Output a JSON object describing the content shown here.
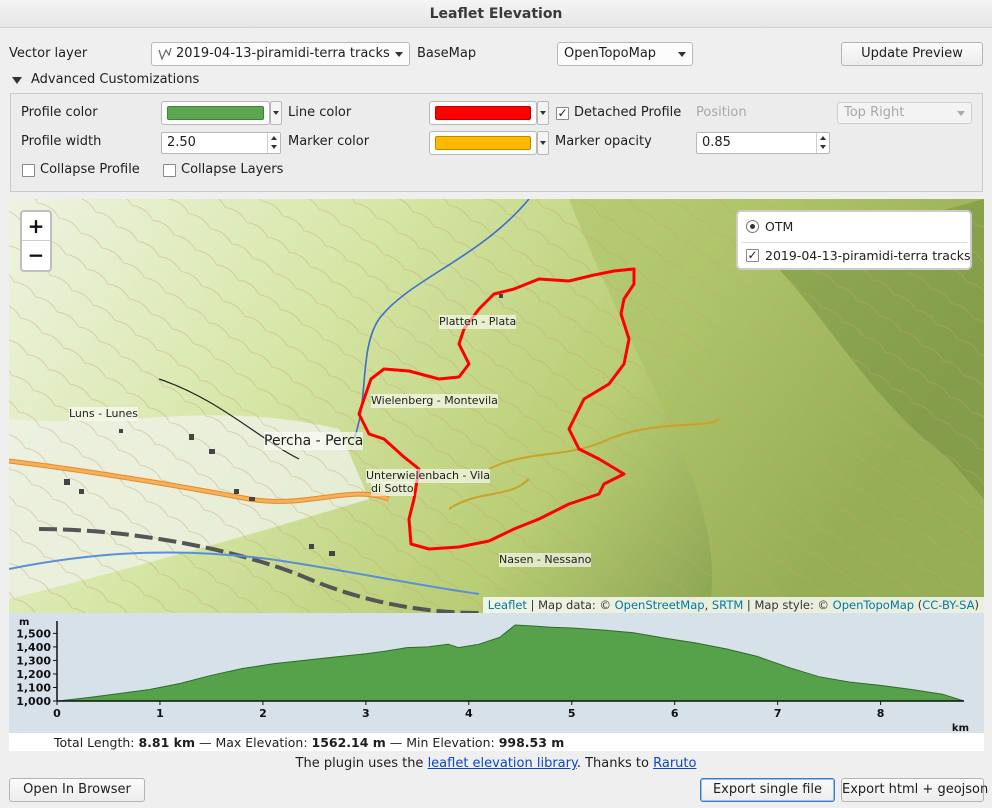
{
  "window": {
    "title": "Leaflet Elevation"
  },
  "top_row": {
    "vector_layer_label": "Vector layer",
    "vector_layer_value": "2019-04-13-piramidi-terra tracks",
    "basemap_label": "BaseMap",
    "basemap_value": "OpenTopoMap",
    "update_button": "Update Preview"
  },
  "advanced": {
    "header": "Advanced Customizations",
    "profile_color_label": "Profile color",
    "profile_color": "#5aa84e",
    "line_color_label": "Line color",
    "line_color": "#ff0000",
    "detached_profile_label": "Detached Profile",
    "detached_profile_checked": true,
    "detached_mark": "✓",
    "position_label": "Position",
    "position_value": "Top Right",
    "profile_width_label": "Profile width",
    "profile_width_value": "2.50",
    "marker_color_label": "Marker color",
    "marker_color": "#ffb800",
    "marker_opacity_label": "Marker opacity",
    "marker_opacity_value": "0.85",
    "collapse_profile_label": "Collapse Profile",
    "collapse_layers_label": "Collapse Layers"
  },
  "map": {
    "zoom_in": "+",
    "zoom_out": "−",
    "layers": {
      "base": "OTM",
      "overlay": "2019-04-13-piramidi-terra tracks",
      "overlay_mark": "✓"
    },
    "places": {
      "platten": "Platten - Plata",
      "wielenberg": "Wielenberg - Montevila",
      "luns": "Luns - Lunes",
      "percha": "Percha - Perca",
      "unterwielen": "Unterwielenbach - Vila",
      "di_sotto": "di Sotto",
      "nasen": "Nasen - Nessano"
    },
    "attribution": {
      "leaflet": "Leaflet",
      "sep1": " | Map data: © ",
      "osm": "OpenStreetMap",
      "comma": ", ",
      "srtm": "SRTM",
      "sep2": " | Map style: © ",
      "otm": "OpenTopoMap",
      "open": " (",
      "license": "CC-BY-SA",
      "close": ")"
    }
  },
  "chart_data": {
    "type": "area",
    "title": "",
    "xlabel": "km",
    "ylabel": "m",
    "xlim": [
      0,
      8.81
    ],
    "ylim": [
      1000,
      1562
    ],
    "x_ticks": [
      "0",
      "1",
      "2",
      "3",
      "4",
      "5",
      "6",
      "7",
      "8"
    ],
    "y_ticks": [
      "1,000",
      "1,100",
      "1,200",
      "1,300",
      "1,400",
      "1,500"
    ],
    "x": [
      0,
      0.3,
      0.6,
      0.9,
      1.2,
      1.5,
      1.8,
      2.1,
      2.4,
      2.7,
      3.0,
      3.2,
      3.4,
      3.6,
      3.8,
      3.9,
      4.1,
      4.3,
      4.45,
      4.6,
      4.8,
      5.0,
      5.3,
      5.6,
      5.9,
      6.2,
      6.5,
      6.8,
      7.1,
      7.4,
      7.7,
      8.0,
      8.3,
      8.6,
      8.81
    ],
    "series": [
      {
        "values": [
          999,
          1025,
          1055,
          1085,
          1130,
          1190,
          1240,
          1275,
          1300,
          1325,
          1350,
          1370,
          1395,
          1400,
          1420,
          1395,
          1420,
          1470,
          1562,
          1555,
          1545,
          1540,
          1525,
          1505,
          1465,
          1430,
          1385,
          1330,
          1250,
          1180,
          1140,
          1115,
          1085,
          1050,
          1000
        ]
      }
    ],
    "color": "#56a24b",
    "background": "#d7e1ea"
  },
  "stats": {
    "total_length_label": "Total Length: ",
    "total_length": "8.81 km",
    "max_elev_label": " — Max Elevation: ",
    "max_elev": "1562.14 m",
    "min_elev_label": " — Min Elevation: ",
    "min_elev": "998.53 m"
  },
  "footer": {
    "text1": "The plugin uses the ",
    "link1": "leaflet elevation library",
    "text2": ". Thanks to ",
    "link2": "Raruto"
  },
  "buttons": {
    "open_browser": "Open In Browser",
    "export_single": "Export single file",
    "export_html": "Export html + geojson"
  }
}
